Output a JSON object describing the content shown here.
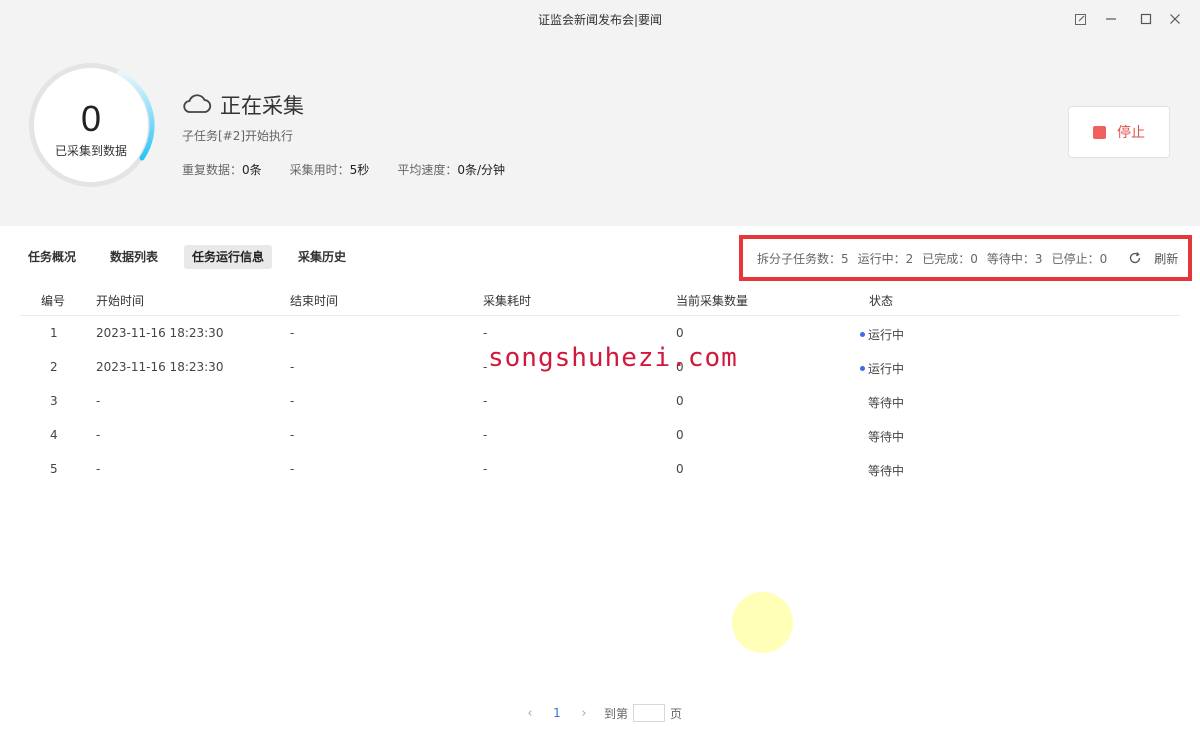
{
  "window": {
    "title": "证监会新闻发布会|要闻"
  },
  "header": {
    "collected_count": "0",
    "collected_label": "已采集到数据",
    "status_title": "正在采集",
    "subtask_message": "子任务[#2]开始执行",
    "stats": [
      {
        "label": "重复数据：",
        "value": "0条"
      },
      {
        "label": "采集用时：",
        "value": "5秒"
      },
      {
        "label": "平均速度：",
        "value": "0条/分钟"
      }
    ],
    "stop_label": "停止"
  },
  "tabs": [
    {
      "label": "任务概况",
      "active": false
    },
    {
      "label": "数据列表",
      "active": false
    },
    {
      "label": "任务运行信息",
      "active": true
    },
    {
      "label": "采集历史",
      "active": false
    }
  ],
  "summary": {
    "items": [
      "拆分子任务数：5",
      "运行中：2",
      "已完成：0",
      "等待中：3",
      "已停止：0"
    ],
    "refresh_label": "刷新"
  },
  "table": {
    "columns": [
      "编号",
      "开始时间",
      "结束时间",
      "采集耗时",
      "当前采集数量",
      "状态"
    ],
    "rows": [
      {
        "id": "1",
        "start": "2023-11-16 18:23:30",
        "end": "-",
        "duration": "-",
        "count": "0",
        "status": "运行中",
        "running": true
      },
      {
        "id": "2",
        "start": "2023-11-16 18:23:30",
        "end": "-",
        "duration": "-",
        "count": "0",
        "status": "运行中",
        "running": true
      },
      {
        "id": "3",
        "start": "-",
        "end": "-",
        "duration": "-",
        "count": "0",
        "status": "等待中",
        "running": false
      },
      {
        "id": "4",
        "start": "-",
        "end": "-",
        "duration": "-",
        "count": "0",
        "status": "等待中",
        "running": false
      },
      {
        "id": "5",
        "start": "-",
        "end": "-",
        "duration": "-",
        "count": "0",
        "status": "等待中",
        "running": false
      }
    ]
  },
  "pager": {
    "current_page": "1",
    "goto_label": "到第",
    "page_suffix": "页"
  },
  "watermark": "songshuhezi.com",
  "colors": {
    "accent_blue": "#3b6fe0",
    "ring_gradient": "#29c5f6",
    "stop_red": "#f0605d",
    "highlight_box": "#e5363a"
  }
}
